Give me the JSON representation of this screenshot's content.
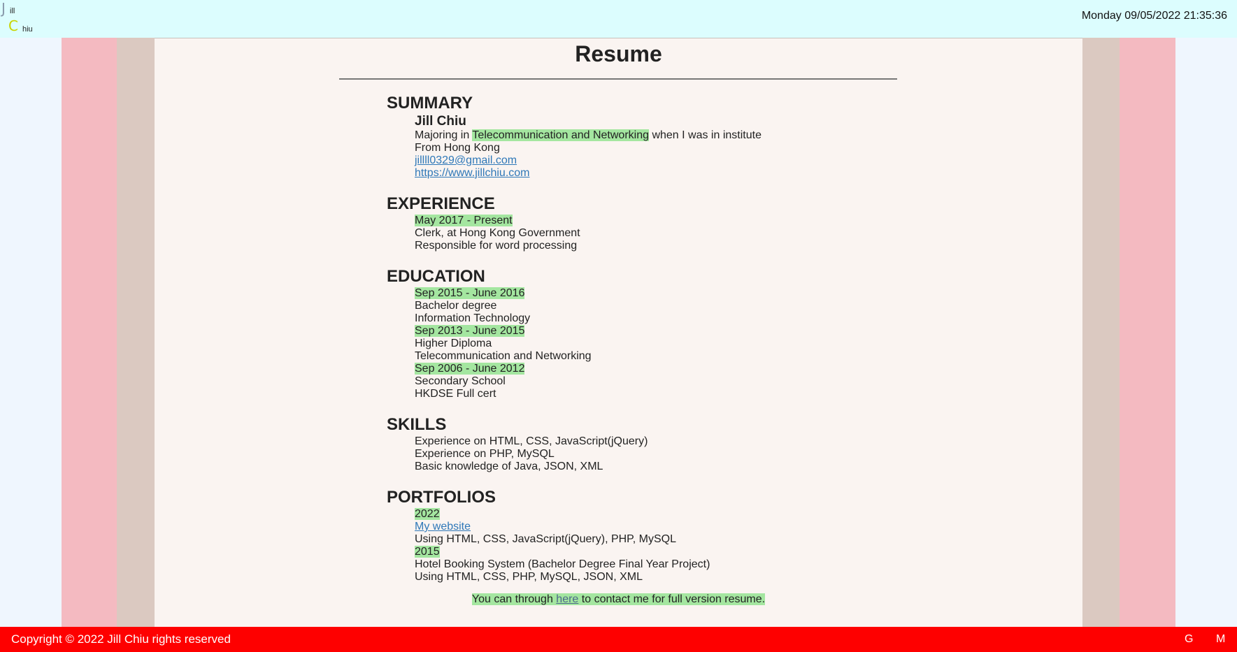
{
  "header": {
    "logo_first_letter": "J",
    "logo_first_rest": "ill",
    "logo_last_letter": "C",
    "logo_last_rest": "hiu",
    "datetime": "Monday 09/05/2022 21:35:36"
  },
  "resume": {
    "title": "Resume",
    "summary": {
      "heading": "SUMMARY",
      "name": "Jill Chiu",
      "major_prefix": "Majoring in ",
      "major_highlight": "Telecommunication and Networking",
      "major_suffix": " when I was in institute",
      "from": "From Hong Kong",
      "email": "jillll0329@gmail.com",
      "website": "https://www.jillchiu.com"
    },
    "experience": {
      "heading": "EXPERIENCE",
      "period": "May 2017 - Present",
      "role": "Clerk, at Hong Kong Government",
      "duty": "Responsible for word processing"
    },
    "education": {
      "heading": "EDUCATION",
      "entries": [
        {
          "period": "Sep 2015 - June 2016",
          "degree": "Bachelor degree",
          "field": "Information Technology"
        },
        {
          "period": "Sep 2013 - June 2015",
          "degree": "Higher Diploma",
          "field": "Telecommunication and Networking"
        },
        {
          "period": "Sep 2006 - June 2012",
          "degree": "Secondary School",
          "field": "HKDSE Full cert"
        }
      ]
    },
    "skills": {
      "heading": "SKILLS",
      "items": [
        "Experience on HTML, CSS, JavaScript(jQuery)",
        "Experience on PHP, MySQL",
        "Basic knowledge of Java, JSON, XML"
      ]
    },
    "portfolios": {
      "heading": "PORTFOLIOS",
      "entries": [
        {
          "year": "2022",
          "title_link": "My website",
          "tech": "Using HTML, CSS, JavaScript(jQuery), PHP, MySQL"
        },
        {
          "year": "2015",
          "title": "Hotel Booking System (Bachelor Degree Final Year Project)",
          "tech": "Using HTML, CSS, PHP, MySQL, JSON, XML"
        }
      ]
    },
    "contact": {
      "prefix": "You can through ",
      "link": "here",
      "suffix": " to contact me for full version resume."
    }
  },
  "footer": {
    "copyright": "Copyright © 2022 Jill Chiu rights reserved",
    "icon_g": "G",
    "icon_m": "M"
  },
  "colors": {
    "topbar": "#dcfdfe",
    "outer_band": "#f4bac1",
    "inner_band": "#dbc9c1",
    "paper": "#faf4f1",
    "highlight": "#a4e6a0",
    "footer": "#fe0000",
    "link": "#2f78b8"
  }
}
